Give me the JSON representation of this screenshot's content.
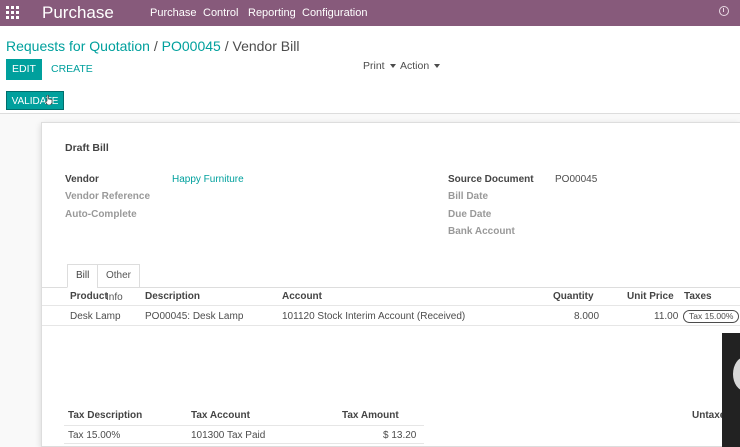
{
  "topbar": {
    "app_name": "Purchase",
    "menu": [
      "Purchase",
      "Control",
      "Reporting",
      "Configuration"
    ],
    "apps_icon": "apps-grid-icon",
    "right_icon": "clock-icon",
    "color": "#875a7b"
  },
  "breadcrumb": {
    "rfq": "Requests for Quotation",
    "sep1": " / ",
    "po": "PO00045",
    "sep2": " / ",
    "current": "Vendor Bill"
  },
  "buttons": {
    "edit": "EDIT",
    "create": "CREATE",
    "print": "Print",
    "action": "Action",
    "validate": "VALIDATE"
  },
  "form": {
    "status": "Draft Bill",
    "left": {
      "vendor_label": "Vendor",
      "vendor_value": "Happy Furniture",
      "vendor_ref_label": "Vendor Reference",
      "auto_complete_label": "Auto-Complete"
    },
    "right": {
      "source_label": "Source Document",
      "source_value": "PO00045",
      "bill_date_label": "Bill Date",
      "due_date_label": "Due Date",
      "bank_account_label": "Bank Account"
    },
    "tabs": [
      "Bill",
      "Other Info"
    ]
  },
  "lines": {
    "headers": [
      "Product",
      "Description",
      "Account",
      "Quantity",
      "Unit Price",
      "Taxes"
    ],
    "rows": [
      {
        "product": "Desk Lamp",
        "description": "PO00045: Desk Lamp",
        "account": "101120 Stock Interim Account (Received)",
        "quantity": "8.000",
        "unit_price": "11.00",
        "taxes": "Tax 15.00%"
      }
    ]
  },
  "tax_table": {
    "headers": [
      "Tax Description",
      "Tax Account",
      "Tax Amount"
    ],
    "rows": [
      {
        "description": "Tax 15.00%",
        "account": "101300 Tax Paid",
        "amount": "$ 13.20"
      }
    ],
    "untaxed_label": "Untaxe"
  },
  "colors": {
    "accent": "#00a09d",
    "brand": "#875a7b"
  }
}
